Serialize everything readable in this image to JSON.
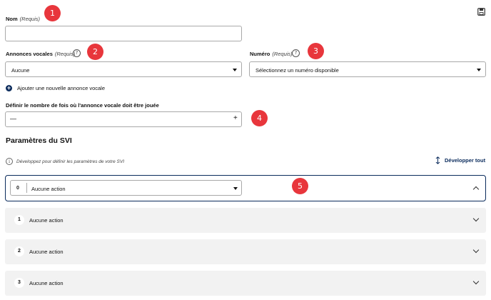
{
  "form": {
    "nom": {
      "label": "Nom",
      "required": "(Requis)",
      "value": ""
    },
    "annonces": {
      "label": "Annonces vocales",
      "required": "(Requis)",
      "help": "?",
      "value": "Aucune"
    },
    "numero": {
      "label": "Numéro",
      "required": "(Requis)",
      "help": "?",
      "value": "Sélectionnez un numéro disponible"
    },
    "add_annonce": "Ajouter une nouvelle annonce vocale",
    "repeat": {
      "label": "Définir le nombre de fois où l'annonce vocale doit être jouée",
      "minus": "—",
      "plus": "+"
    }
  },
  "svi": {
    "title": "Paramètres du SVI",
    "hint": "Développez pour définir les paramètres de votre SVI",
    "expand_all": "Développer tout",
    "open_item": {
      "key": "0",
      "value": "Aucune action"
    },
    "items": [
      {
        "key": "1",
        "value": "Aucune action"
      },
      {
        "key": "2",
        "value": "Aucune action"
      },
      {
        "key": "3",
        "value": "Aucune action"
      }
    ]
  },
  "badges": [
    "1",
    "2",
    "3",
    "4",
    "5"
  ],
  "icons": {
    "save": "save-icon",
    "help": "question-icon",
    "info": "info-icon",
    "add": "plus-circle-icon",
    "expand": "expand-vertical-icon"
  },
  "colors": {
    "accent": "#0a2b5c",
    "badge": "#e8363c",
    "panel_bg": "#f2f2f2",
    "border": "#a9a9a9"
  }
}
